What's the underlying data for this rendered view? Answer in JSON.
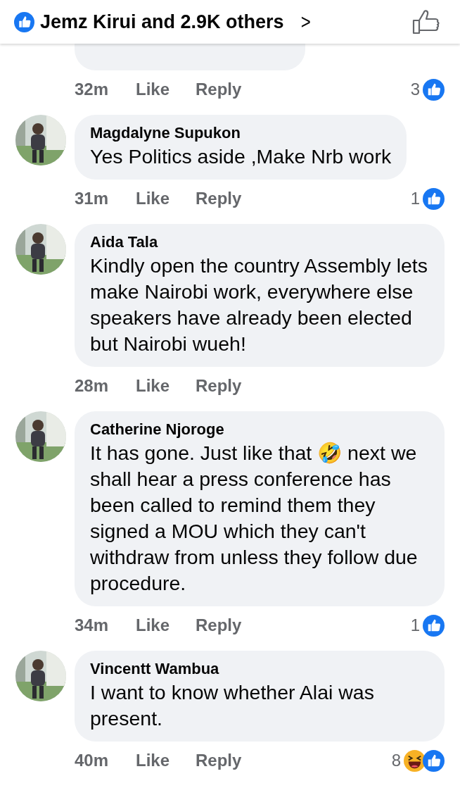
{
  "header": {
    "reactor_text": "Jemz Kirui and 2.9K others",
    "chevron": ">"
  },
  "comments": [
    {
      "kind": "partial",
      "time": "32m",
      "actions": [
        "Like",
        "Reply"
      ],
      "reaction_count": "3",
      "reactions": [
        {
          "kind": "like"
        }
      ]
    },
    {
      "kind": "full",
      "avatar": {
        "kind": "picture"
      },
      "author": "Magdalyne Supukon",
      "text": "Yes Politics aside ,Make Nrb work",
      "time": "31m",
      "actions": [
        "Like",
        "Reply"
      ],
      "reaction_count": "1",
      "reactions": [
        {
          "kind": "like"
        }
      ]
    },
    {
      "kind": "full",
      "avatar": {
        "kind": "picture"
      },
      "author": "Aida Tala",
      "text": "Kindly open the country Assembly lets make Nairobi work, everywhere else speakers have already been elected but Nairobi wueh!",
      "time": "28m",
      "actions": [
        "Like",
        "Reply"
      ]
    },
    {
      "kind": "full",
      "avatar": {
        "kind": "picture"
      },
      "author": "Catherine Njoroge",
      "text": "It has gone. Just like that 🤣 next we shall hear a press conference has been called to remind them they signed a MOU which they can't withdraw from unless they follow due procedure.",
      "time": "34m",
      "actions": [
        "Like",
        "Reply"
      ],
      "reaction_count": "1",
      "reactions": [
        {
          "kind": "like"
        }
      ]
    },
    {
      "kind": "full",
      "avatar": {
        "kind": "picture"
      },
      "author": "Vincentt Wambua",
      "text": "I want to know whether Alai was present.",
      "time": "40m",
      "actions": [
        "Like",
        "Reply"
      ],
      "reaction_count": "8",
      "reactions": [
        {
          "kind": "haha"
        },
        {
          "kind": "like"
        }
      ]
    }
  ]
}
